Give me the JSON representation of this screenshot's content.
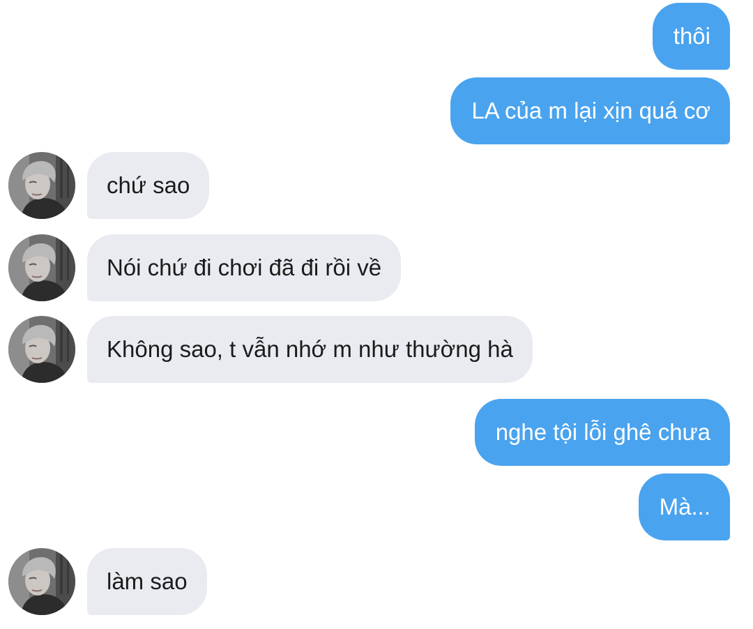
{
  "conversation": {
    "messages": [
      {
        "side": "sent",
        "text": "thôi"
      },
      {
        "side": "sent",
        "text": "LA của m lại xịn quá cơ"
      },
      {
        "side": "received",
        "text": "chứ sao"
      },
      {
        "side": "received",
        "text": "Nói chứ đi chơi đã đi rồi về"
      },
      {
        "side": "received",
        "text": "Không sao, t vẫn nhớ m như thường hà"
      },
      {
        "side": "sent",
        "text": "nghe tội lỗi ghê chưa"
      },
      {
        "side": "sent",
        "text": "Mà..."
      },
      {
        "side": "received",
        "text": "làm sao"
      }
    ]
  },
  "colors": {
    "sent_bubble": "#4aa3ee",
    "received_bubble": "#e9ebf0",
    "background": "#ffffff"
  },
  "icons": {
    "avatar": "contact-avatar-photo"
  }
}
